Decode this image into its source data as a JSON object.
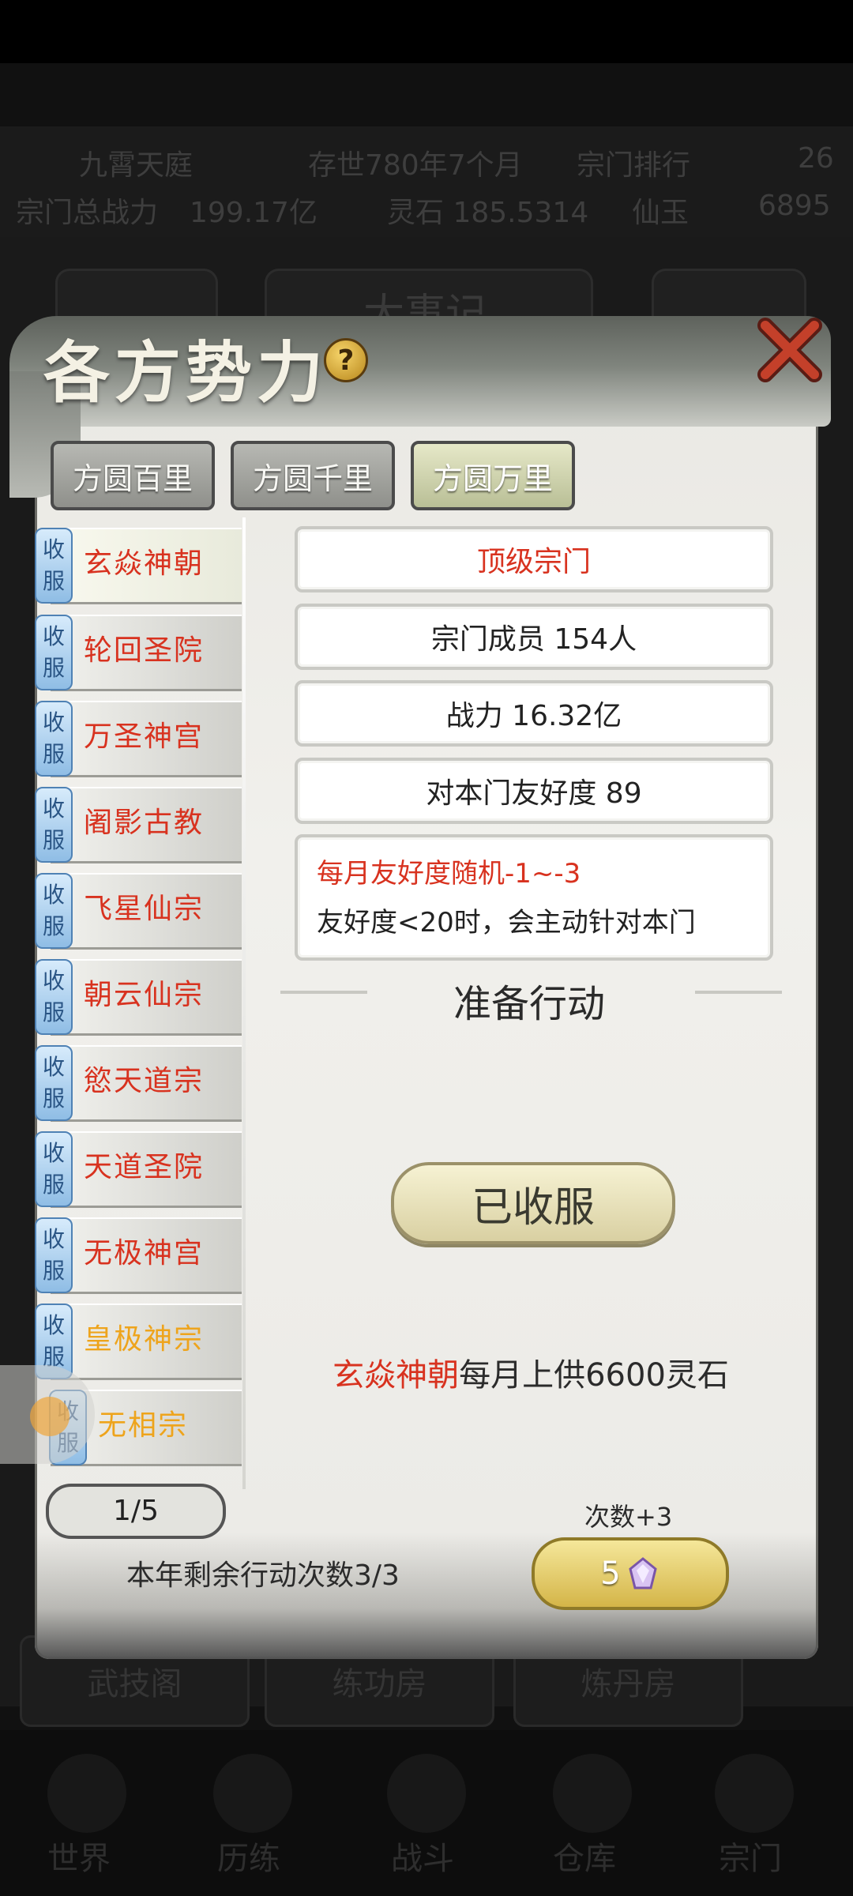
{
  "background": {
    "stats_row1": [
      "九霄天庭",
      "存世780年7个月",
      "宗门排行",
      "26"
    ],
    "stats_row2": [
      "宗门总战力",
      "199.17亿",
      "灵石 185.5314",
      "仙玉",
      "6895"
    ],
    "tab_label": "大事记",
    "bottom_buttons": [
      "武技阁",
      "练功房",
      "炼丹房"
    ],
    "nav": [
      "世界",
      "历练",
      "战斗",
      "仓库",
      "宗门"
    ]
  },
  "dialog": {
    "title": "各方势力",
    "help_label": "?",
    "region_tabs": [
      {
        "label": "方圆百里",
        "active": false
      },
      {
        "label": "方圆千里",
        "active": false
      },
      {
        "label": "方圆万里",
        "active": true
      }
    ],
    "factions": [
      {
        "badge": "收服",
        "name": "玄焱神朝",
        "color": "red",
        "active": true
      },
      {
        "badge": "收服",
        "name": "轮回圣院",
        "color": "red"
      },
      {
        "badge": "收服",
        "name": "万圣神宫",
        "color": "red"
      },
      {
        "badge": "收服",
        "name": "阇影古教",
        "color": "red"
      },
      {
        "badge": "收服",
        "name": "飞星仙宗",
        "color": "red"
      },
      {
        "badge": "收服",
        "name": "朝云仙宗",
        "color": "red"
      },
      {
        "badge": "收服",
        "name": "慾天道宗",
        "color": "red"
      },
      {
        "badge": "收服",
        "name": "天道圣院",
        "color": "red"
      },
      {
        "badge": "收服",
        "name": "无极神宫",
        "color": "red"
      },
      {
        "badge": "收服",
        "name": "皇极神宗",
        "color": "orange"
      },
      {
        "badge": "收服",
        "name": "无相宗",
        "color": "orange"
      }
    ],
    "pager": {
      "text": "1/5"
    },
    "info": {
      "rank": "顶级宗门",
      "members": "宗门成员 154人",
      "power": "战力 16.32亿",
      "friendship": "对本门友好度 89",
      "desc_line1": "每月友好度随机-1~-3",
      "desc_line2": "友好度<20时，会主动针对本门"
    },
    "section_title": "准备行动",
    "main_button": "已收服",
    "tribute_name": "玄焱神朝",
    "tribute_text": "每月上供6600灵石",
    "remaining_actions": "本年剩余行动次数3/3",
    "times_bonus": "次数+3",
    "cost_value": "5",
    "colors": {
      "red": "#d8321f",
      "orange": "#eea41c",
      "badge": "#8fbde5"
    }
  }
}
